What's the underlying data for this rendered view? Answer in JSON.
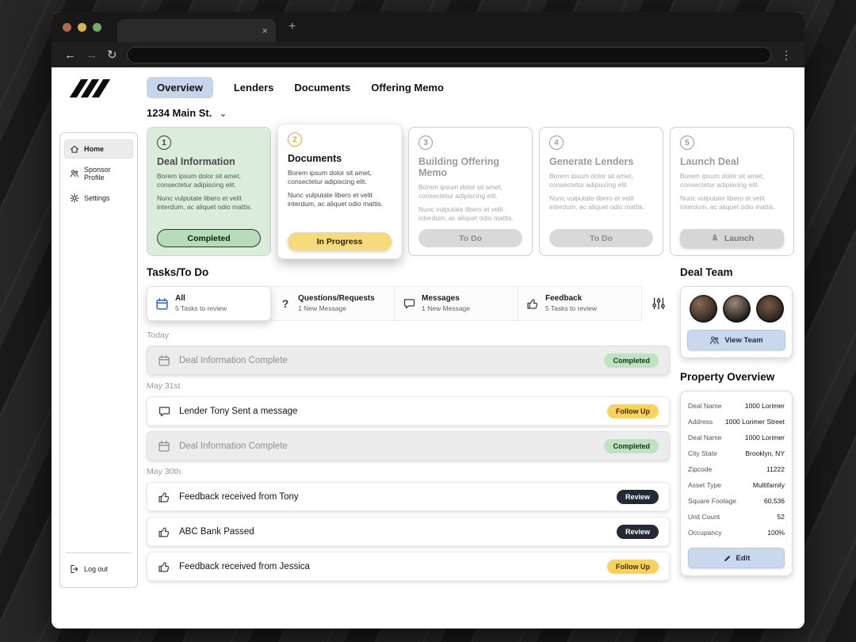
{
  "browser": {
    "tab_title": "",
    "close_icon": "×",
    "new_tab_icon": "+",
    "back_icon": "←",
    "forward_icon": "→",
    "refresh_icon": "↻",
    "menu_icon": "⋮"
  },
  "nav": {
    "items": [
      "Overview",
      "Lenders",
      "Documents",
      "Offering Memo"
    ],
    "active": "Overview"
  },
  "property_selector": {
    "label": "1234 Main St.",
    "chevron": "⌄"
  },
  "sidebar": {
    "items": [
      {
        "label": "Home"
      },
      {
        "label": "Sponsor Profile"
      },
      {
        "label": "Settings"
      }
    ],
    "logout_label": "Log out"
  },
  "steps": {
    "body1": "Borem ipsum dolor sit amet, consectetur adipiscing elit.",
    "body2": "Nunc vulputate libero et velit interdum, ac aliquet odio mattis.",
    "items": [
      {
        "num": "1",
        "title": "Deal Information",
        "status": "Completed"
      },
      {
        "num": "2",
        "title": "Documents",
        "status": "In Progress"
      },
      {
        "num": "3",
        "title": "Building Offering Memo",
        "status": "To Do"
      },
      {
        "num": "4",
        "title": "Generate Lenders",
        "status": "To Do"
      },
      {
        "num": "5",
        "title": "Launch Deal",
        "status": "Launch"
      }
    ]
  },
  "tasks": {
    "heading": "Tasks/To Do",
    "question_icon": "?",
    "filters": [
      {
        "title": "All",
        "subtitle": "5 Tasks to review"
      },
      {
        "title": "Questions/Requests",
        "subtitle": "1 New Message"
      },
      {
        "title": "Messages",
        "subtitle": "1 New Message"
      },
      {
        "title": "Feedback",
        "subtitle": "5 Tasks to review"
      }
    ],
    "groups": [
      {
        "label": "Today",
        "items": [
          {
            "text": "Deal Information Complete",
            "badge": "Completed",
            "variant": "completed"
          }
        ]
      },
      {
        "label": "May 31st",
        "items": [
          {
            "text": "Lender Tony Sent a message",
            "badge": "Follow Up",
            "variant": "followup"
          },
          {
            "text": "Deal Information Complete",
            "badge": "Completed",
            "variant": "completed"
          }
        ]
      },
      {
        "label": "May 30th",
        "items": [
          {
            "text": "Feedback received from Tony",
            "badge": "Review",
            "variant": "review"
          },
          {
            "text": "ABC Bank Passed",
            "badge": "Review",
            "variant": "review"
          },
          {
            "text": "Feedback received from Jessica",
            "badge": "Follow Up",
            "variant": "followup"
          }
        ]
      }
    ]
  },
  "deal_team": {
    "heading": "Deal Team",
    "button_label": "View Team"
  },
  "property_overview": {
    "heading": "Property Overview",
    "rows": [
      {
        "label": "Deal Name",
        "value": "1000 Lorimer"
      },
      {
        "label": "Address",
        "value": "1000 Lorimer Street"
      },
      {
        "label": "Deal Name",
        "value": "1000 Lorimer"
      },
      {
        "label": "City State",
        "value": "Brooklyn, NY"
      },
      {
        "label": "Zipcode",
        "value": "11222"
      },
      {
        "label": "Asset Type",
        "value": "Multifamily"
      },
      {
        "label": "Square Footage",
        "value": "60,536"
      },
      {
        "label": "Unit Count",
        "value": "52"
      },
      {
        "label": "Occupancy",
        "value": "100%"
      }
    ],
    "edit_label": "Edit"
  },
  "colors": {
    "nav_active_bg": "#c7d5ea",
    "step_completed_card_bg": "#dcecdb",
    "pill_completed_bg": "#b7ddb8",
    "pill_in_progress_bg": "#f6db7d",
    "pill_todo_bg": "#d9d9d9",
    "badge_followup_bg": "#f7d35e",
    "badge_review_bg": "#232a35",
    "action_button_bg": "#c9d8ec",
    "step2_number_accent": "#e0a93e"
  }
}
